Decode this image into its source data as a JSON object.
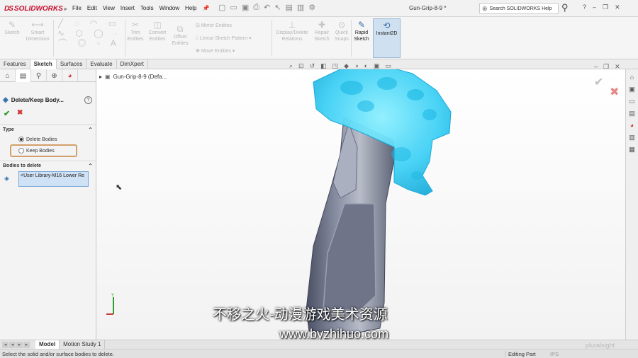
{
  "app": {
    "brand": "SOLIDWORKS",
    "brand_prefix": "DS",
    "menu": [
      "File",
      "Edit",
      "View",
      "Insert",
      "Tools",
      "Window",
      "Help"
    ],
    "document_title": "Gun-Grip-8-9 *",
    "search_placeholder": "Search SOLIDWORKS Help"
  },
  "ribbon": {
    "sketch": "Sketch",
    "smart_dimension": [
      "Smart",
      "Dimension"
    ],
    "trim_entities": [
      "Trim",
      "Entities"
    ],
    "convert_entities": [
      "Convert",
      "Entities"
    ],
    "offset_entities": [
      "Offset",
      "Entities"
    ],
    "mirror_entities": "Mirror Entities",
    "linear_pattern": "Linear Sketch Pattern",
    "move_entities": "Move Entities",
    "display_delete": [
      "Display/Delete",
      "Relations"
    ],
    "repair_sketch": [
      "Repair",
      "Sketch"
    ],
    "quick_snaps": [
      "Quick",
      "Snaps"
    ],
    "rapid_sketch": [
      "Rapid",
      "Sketch"
    ],
    "instant2d": "Instant2D"
  },
  "tabs": [
    "Features",
    "Sketch",
    "Surfaces",
    "Evaluate",
    "DimXpert"
  ],
  "active_tab": "Sketch",
  "property_manager": {
    "title": "Delete/Keep Body...",
    "help": "?",
    "type_section": "Type",
    "option_delete": "Delete Bodies",
    "option_keep": "Keep Bodies",
    "selected_option": "Delete Bodies",
    "bodies_section": "Bodies to delete",
    "bodies_list_item": "<User Library-M16 Lower Re"
  },
  "graphics": {
    "tree_root": "Gun-Grip-8-9  (Defa..."
  },
  "watermark": {
    "line1": "不移之火-动漫游戏美术资源",
    "line2": "www.byzhihuo.com"
  },
  "bottom_tabs": [
    "Model",
    "Motion Study 1"
  ],
  "active_bottom_tab": "Model",
  "status": {
    "message": "Select the solid and/or surface bodies to delete.",
    "mode": "Editing Part",
    "units": "IPS"
  },
  "branding_overlay": "pluralsight",
  "colors": {
    "accent": "#2a6da8",
    "brand_red": "#c8102e",
    "selected_body": "#4fd3ff",
    "body_gray": "#6d7386",
    "highlight_box": "#d2a06c"
  }
}
